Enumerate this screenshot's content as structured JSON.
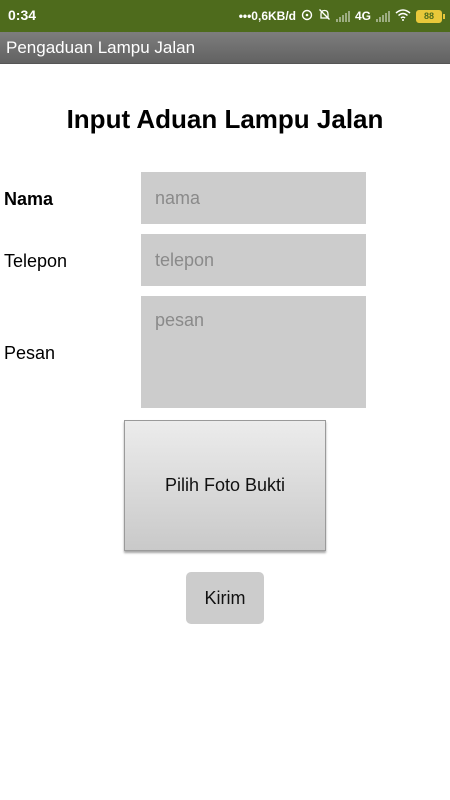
{
  "status_bar": {
    "time": "0:34",
    "network_speed": "•••0,6KB/d",
    "network_type": "4G",
    "battery_level": "88",
    "icons": [
      "sync-icon",
      "alarm-off-icon",
      "signal-icon",
      "wifi-icon",
      "battery-icon"
    ]
  },
  "app": {
    "title": "Pengaduan Lampu Jalan"
  },
  "form": {
    "heading": "Input Aduan Lampu Jalan",
    "nama_label": "Nama",
    "nama_placeholder": "nama",
    "nama_value": "",
    "telepon_label": "Telepon",
    "telepon_placeholder": "telepon",
    "telepon_value": "",
    "pesan_label": "Pesan",
    "pesan_placeholder": "pesan",
    "pesan_value": "",
    "pick_photo_label": "Pilih Foto Bukti",
    "submit_label": "Kirim"
  },
  "colors": {
    "status_bar": "#4e6b1c",
    "title_bar": "#6e6e6e",
    "input_background": "#cccccc",
    "battery": "#e9c83a"
  }
}
